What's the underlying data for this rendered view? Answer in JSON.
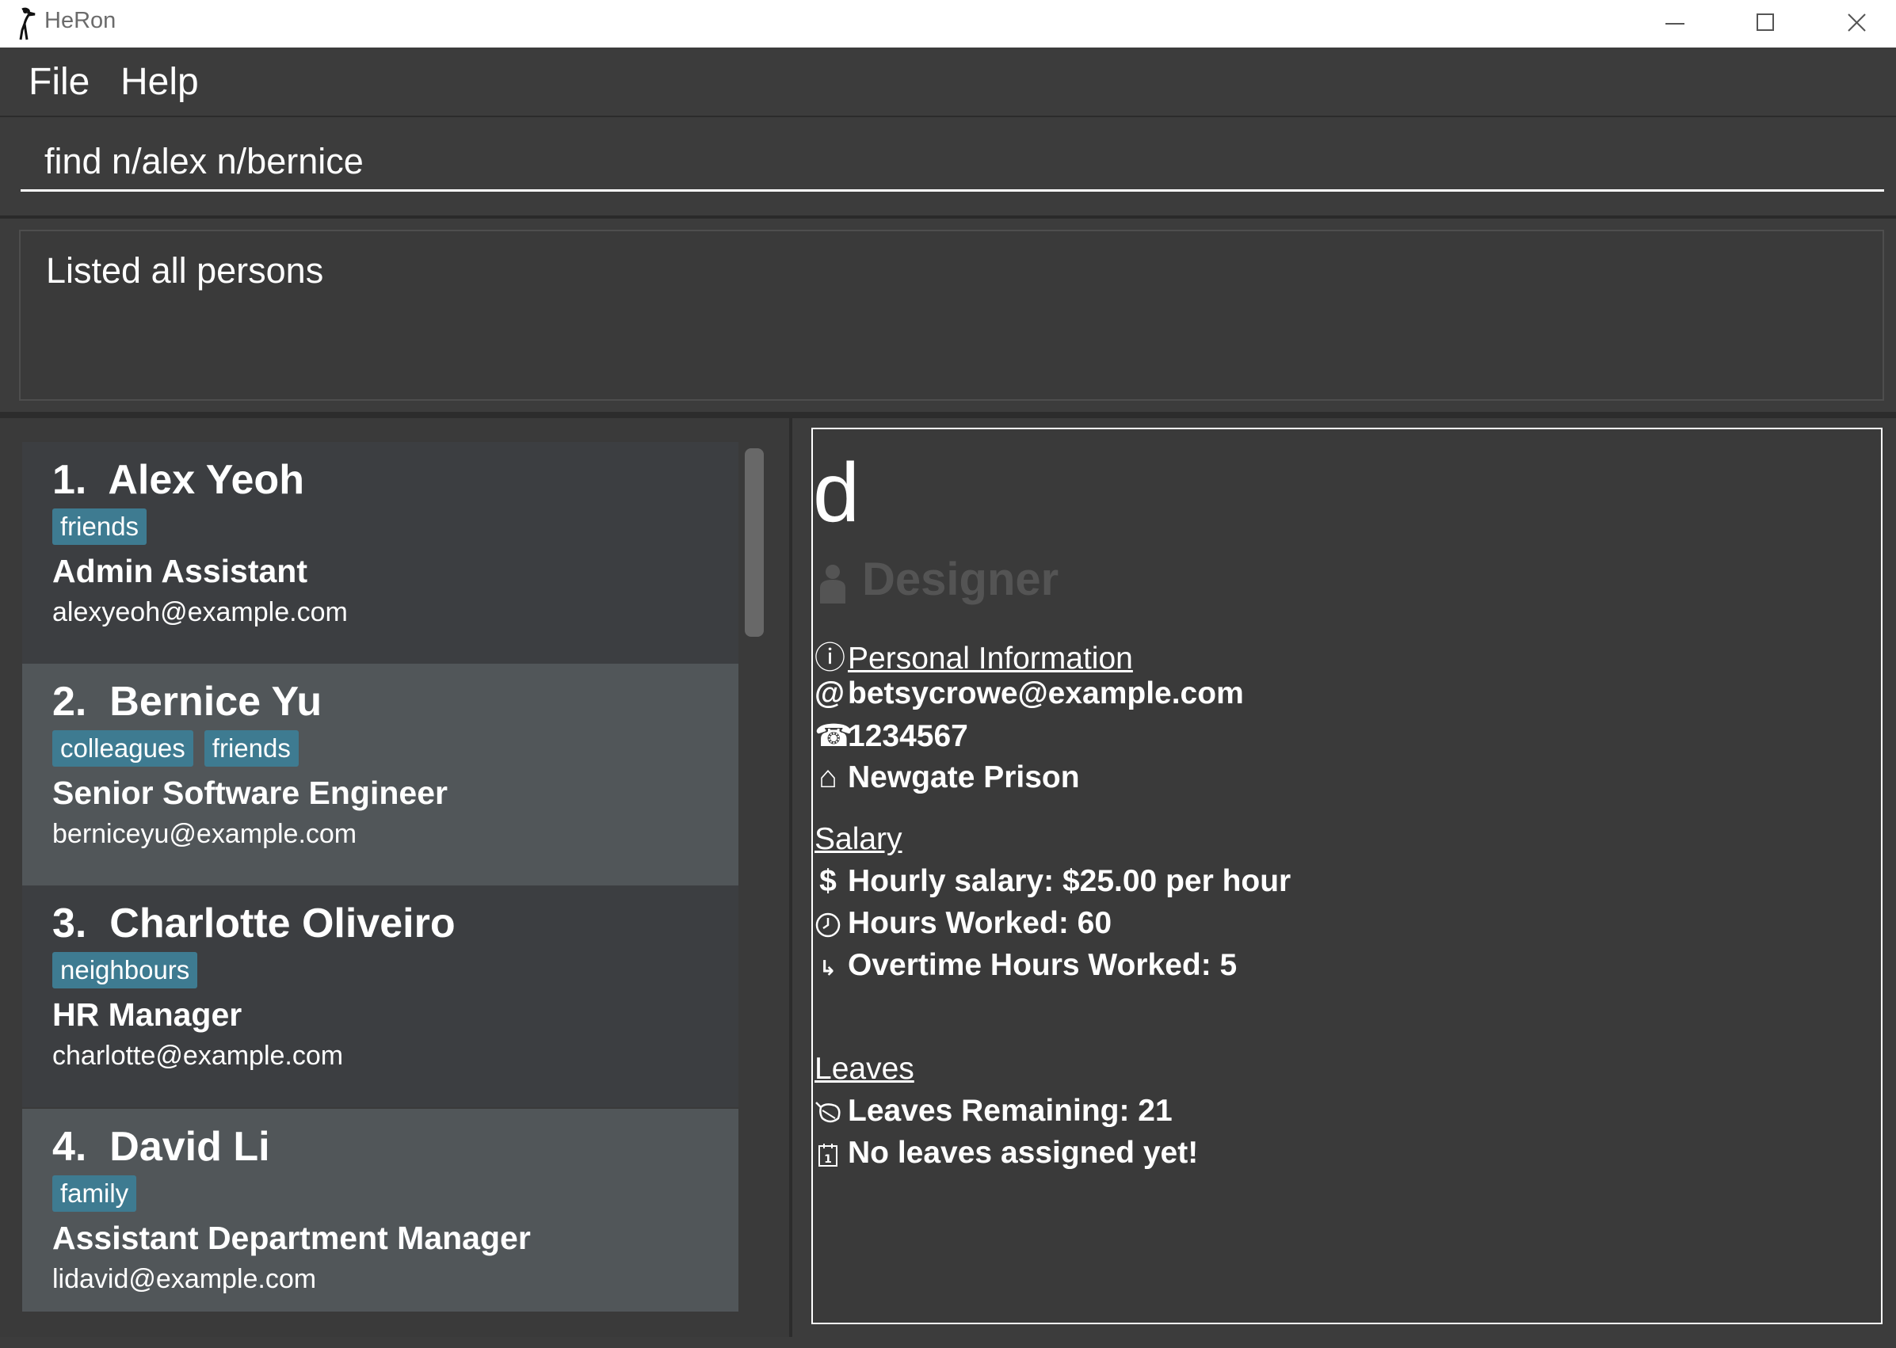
{
  "window": {
    "title": "HeRon"
  },
  "menu": {
    "file": "File",
    "help": "Help"
  },
  "command": {
    "value": "find n/alex n/bernice"
  },
  "result": {
    "message": "Listed all persons"
  },
  "persons": [
    {
      "index": "1.",
      "name": "Alex Yeoh",
      "tags": [
        "friends"
      ],
      "role": "Admin Assistant",
      "email": "alexyeoh@example.com"
    },
    {
      "index": "2.",
      "name": "Bernice Yu",
      "tags": [
        "colleagues",
        "friends"
      ],
      "role": "Senior Software Engineer",
      "email": "berniceyu@example.com"
    },
    {
      "index": "3.",
      "name": "Charlotte Oliveiro",
      "tags": [
        "neighbours"
      ],
      "role": "HR Manager",
      "email": "charlotte@example.com"
    },
    {
      "index": "4.",
      "name": "David Li",
      "tags": [
        "family"
      ],
      "role": "Assistant Department Manager",
      "email": "lidavid@example.com"
    }
  ],
  "detail": {
    "name": "d",
    "role": "Designer",
    "personal_heading": "Personal Information",
    "email": "betsycrowe@example.com",
    "phone": "1234567",
    "address": "Newgate Prison",
    "salary_heading": "Salary",
    "hourly_salary": "Hourly salary: $25.00 per hour",
    "hours_worked": "Hours Worked: 60",
    "overtime": "Overtime Hours Worked: 5",
    "leaves_heading": "Leaves",
    "leaves_remaining": "Leaves Remaining: 21",
    "leaves_status": "No leaves assigned yet!"
  },
  "icons": {
    "info": "ⓘ",
    "email": "@",
    "phone": "☎",
    "home": "⌂",
    "dollar": "$",
    "clock": "clock",
    "overtime": "↳",
    "leaf": "leaf",
    "calendar": "calendar",
    "person": "person"
  }
}
